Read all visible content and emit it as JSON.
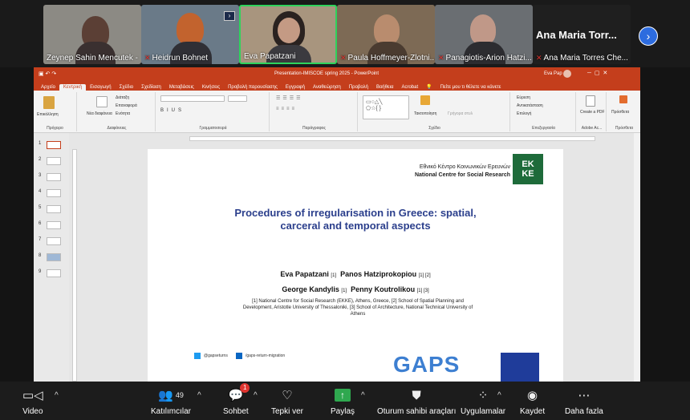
{
  "participants": [
    {
      "name": "Zeynep Sahin Mencutek -",
      "muted": false,
      "bg": "#8c8a84"
    },
    {
      "name": "Heidrun Bohnet",
      "muted": true,
      "bg": "#6a7a88"
    },
    {
      "name": "Eva Papatzani",
      "muted": false,
      "bg": "#a8957e",
      "active": true
    },
    {
      "name": "Paula Hoffmeyer-Zlotni...",
      "muted": true,
      "bg": "#7d6a55"
    },
    {
      "name": "Panagiotis-Arion Hatzi...",
      "muted": true,
      "bg": "#6a6e72"
    },
    {
      "name": "Ana Maria Torres Che...",
      "muted": true,
      "bg": "#1f1f1f"
    }
  ],
  "speaker_big_name": "Ana Maria Torr...",
  "ppt": {
    "title": "Presentation-IMISCOE spring 2025  -  PowerPoint",
    "search": "Πείτε μου τι θέλετε να κάνετε",
    "user": "Eva Pap",
    "tabs": [
      "Αρχείο",
      "Κεντρική",
      "Εισαγωγή",
      "Σχέδιο",
      "Σχεδίαση",
      "Μεταβάσεις",
      "Κινήσεις",
      "Προβολή παρουσίασης",
      "Εγγραφή",
      "Αναθεώρηση",
      "Προβολή",
      "Βοήθεια",
      "Acrobat"
    ],
    "groups": [
      "Πρόχειρο",
      "Διαφάνειες",
      "Γραμματοσειρά",
      "Παράγραφος",
      "Σχέδιο",
      "Επεξεργασία",
      "Adobe Ac...",
      "Πρόσθετα"
    ],
    "buttons": {
      "paste": "Επικόλληση",
      "new_slide": "Νέα διαφάνεια",
      "layout": "Διάταξη",
      "reset": "Επαναφορά",
      "section": "Ενότητα",
      "arrange": "Τακτοποίηση",
      "quick_styles": "Γρήγορα στυλ",
      "find": "Εύρεση",
      "replace": "Αντικατάσταση",
      "select": "Επιλογή",
      "create_pdf": "Create a PDF",
      "addins": "Πρόσθετα"
    },
    "slide_numbers": [
      "1",
      "2",
      "3",
      "4",
      "5",
      "6",
      "7",
      "8",
      "9"
    ]
  },
  "slide": {
    "org_greek": "Εθνικό Κέντρο Κοινωνικών Ερευνών",
    "org_english": "National Centre for Social Research",
    "logo_text": "EK KE",
    "title_line1": "Procedures of irregularisation in Greece: spatial,",
    "title_line2": "carceral and temporal aspects",
    "authors_line1_a": "Eva Papatzani",
    "authors_line1_a_sup": "[1]",
    "authors_line1_b": "Panos Hatziprokopiou",
    "authors_line1_b_sup": "[1] [2]",
    "authors_line2_a": "George Kandylis",
    "authors_line2_a_sup": "[1]",
    "authors_line2_b": "Penny Koutrolikou",
    "authors_line2_b_sup": "[1] [3]",
    "affiliations": "[1] National Centre for Social Research (EKKE), Athens, Greece, [2] School of Spatial Planning and Development, Aristotle University of Thessaloniki, [3] School of Architecture, National Technical University of Athens",
    "twitter": "@gapseturns",
    "linkedin": "/gaps-return-migration",
    "gaps_logo": "GAPS"
  },
  "toolbar": {
    "video": "Video",
    "participants": "Katılımcılar",
    "participants_count": "49",
    "chat": "Sohbet",
    "chat_badge": "1",
    "react": "Tepki ver",
    "share": "Paylaş",
    "host_tools": "Oturum sahibi araçları",
    "apps": "Uygulamalar",
    "record": "Kaydet",
    "more": "Daha fazla"
  }
}
